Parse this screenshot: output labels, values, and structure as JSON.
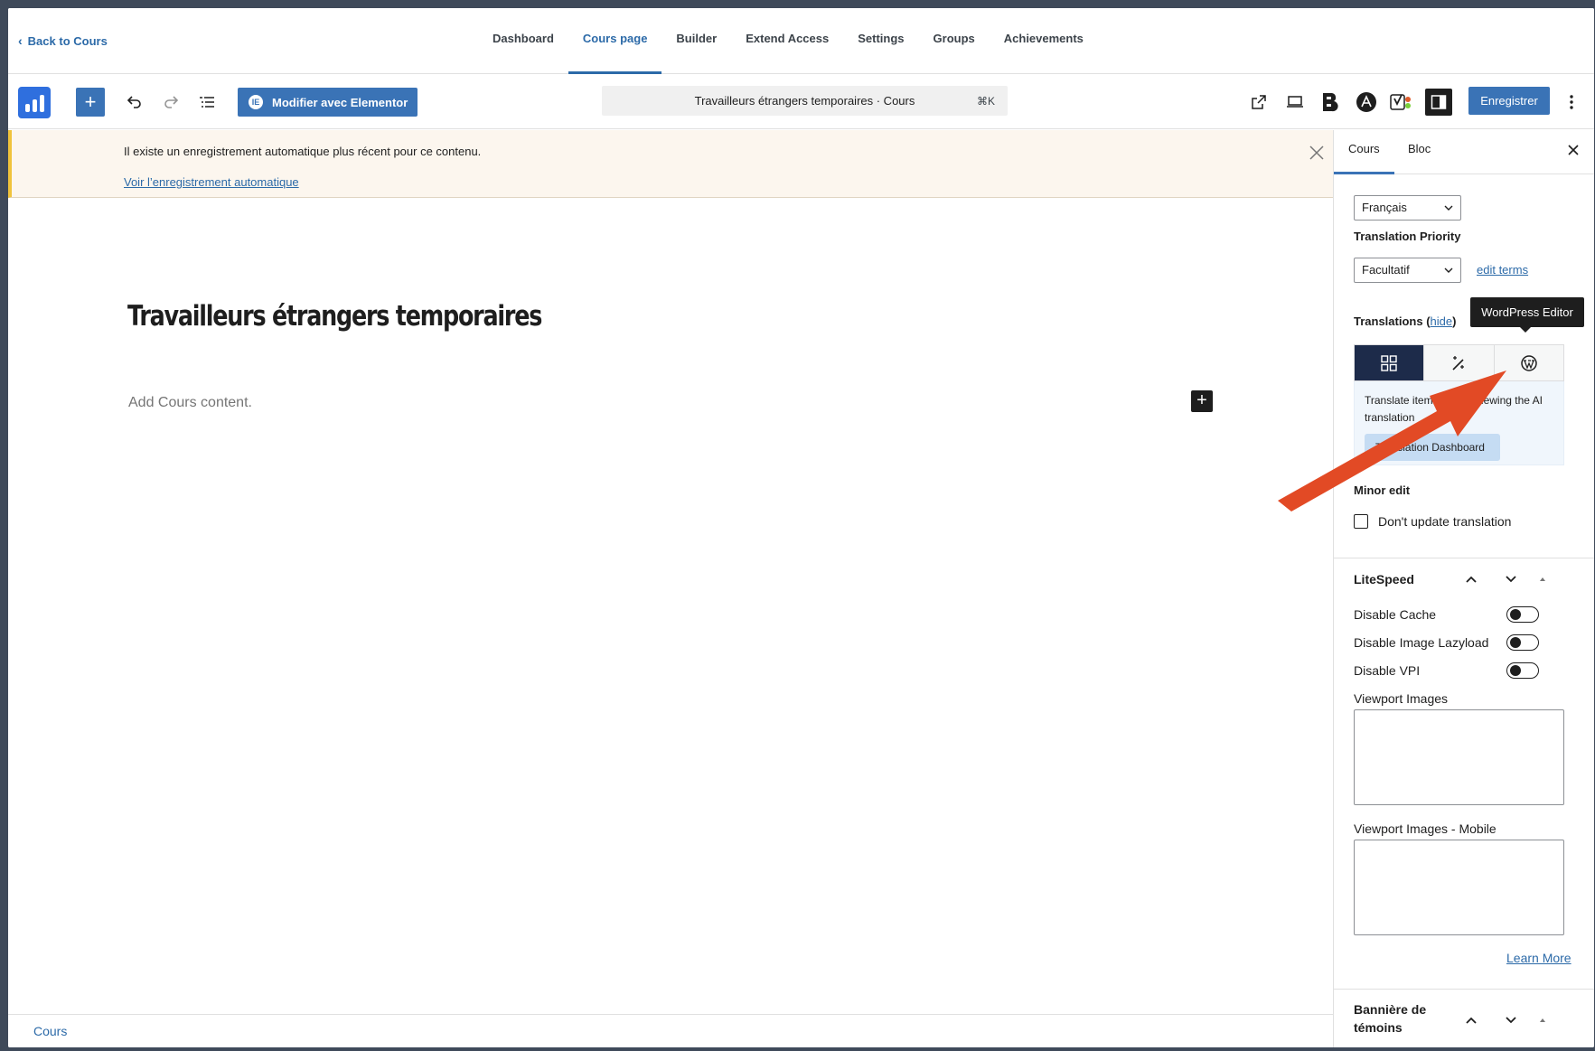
{
  "topnav": {
    "back_label": "Back to Cours",
    "tabs": [
      {
        "label": "Dashboard"
      },
      {
        "label": "Cours page"
      },
      {
        "label": "Builder"
      },
      {
        "label": "Extend Access"
      },
      {
        "label": "Settings"
      },
      {
        "label": "Groups"
      },
      {
        "label": "Achievements"
      }
    ]
  },
  "toolbar": {
    "elementor_label": "Modifier avec Elementor",
    "elementor_badge": "IE",
    "document_title": "Travailleurs étrangers temporaires · Cours",
    "shortcut": "⌘K",
    "save_label": "Enregistrer",
    "accent_color": "#3a73b6"
  },
  "notice": {
    "message": "Il existe un enregistrement automatique plus récent pour ce contenu.",
    "link": "Voir l’enregistrement automatique"
  },
  "canvas": {
    "title": "Travailleurs étrangers temporaires",
    "placeholder": "Add Cours content."
  },
  "footer": {
    "breadcrumb": "Cours"
  },
  "sidebar": {
    "tabs": [
      {
        "label": "Cours"
      },
      {
        "label": "Bloc"
      }
    ],
    "language_select": "Français",
    "translation_priority_label": "Translation Priority",
    "priority_select": "Facultatif",
    "edit_terms": "edit terms",
    "translations_label": "Translations (",
    "translations_hide": "hide",
    "translations_close_paren": ")",
    "tooltip": "WordPress Editor",
    "translate_text": "Translate items after reviewing the AI translation",
    "dashboard_button": "Translation Dashboard",
    "minor_edit_label": "Minor edit",
    "dont_update_label": "Don't update translation",
    "litespeed": {
      "title": "LiteSpeed",
      "toggles": [
        {
          "label": "Disable Cache",
          "on": false
        },
        {
          "label": "Disable Image Lazyload",
          "on": false
        },
        {
          "label": "Disable VPI",
          "on": false
        }
      ],
      "viewport_images_label": "Viewport Images",
      "viewport_images_mobile_label": "Viewport Images - Mobile",
      "learn_more": "Learn More"
    },
    "banner_title": "Bannière de témoins"
  }
}
